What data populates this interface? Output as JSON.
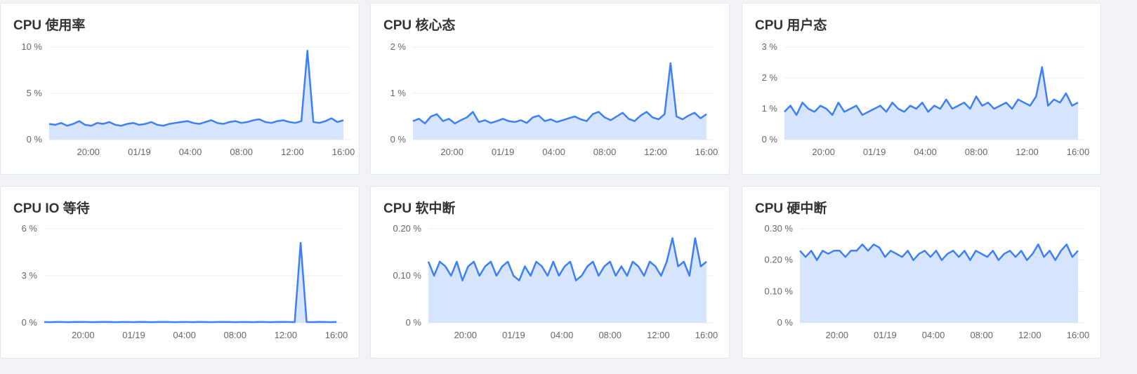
{
  "colors": {
    "line": "#3d7ff5",
    "area": "#d6e4fd",
    "grid": "#eeeeee",
    "tick": "#666666"
  },
  "chart_data": [
    {
      "type": "area",
      "title": "CPU 使用率",
      "yticks": [
        "10 %",
        "5 %",
        "0 %"
      ],
      "ylim": [
        0,
        10
      ],
      "xticks": [
        "20:00",
        "01/19",
        "04:00",
        "08:00",
        "12:00",
        "16:00"
      ],
      "series": [
        {
          "values": [
            1.7,
            1.6,
            1.8,
            1.5,
            1.7,
            2.0,
            1.6,
            1.5,
            1.8,
            1.7,
            1.9,
            1.6,
            1.5,
            1.7,
            1.8,
            1.6,
            1.7,
            1.9,
            1.6,
            1.5,
            1.7,
            1.8,
            1.9,
            2.0,
            1.8,
            1.7,
            1.9,
            2.1,
            1.8,
            1.7,
            1.9,
            2.0,
            1.8,
            1.9,
            2.1,
            2.2,
            1.9,
            1.8,
            2.0,
            2.1,
            1.9,
            1.8,
            2.0,
            9.6,
            1.9,
            1.8,
            2.0,
            2.3,
            1.9,
            2.1
          ]
        }
      ]
    },
    {
      "type": "area",
      "title": "CPU 核心态",
      "yticks": [
        "2 %",
        "1 %",
        "0 %"
      ],
      "ylim": [
        0,
        2
      ],
      "xticks": [
        "20:00",
        "01/19",
        "04:00",
        "08:00",
        "12:00",
        "16:00"
      ],
      "series": [
        {
          "values": [
            0.4,
            0.45,
            0.35,
            0.5,
            0.55,
            0.4,
            0.45,
            0.35,
            0.42,
            0.48,
            0.6,
            0.38,
            0.42,
            0.36,
            0.4,
            0.45,
            0.4,
            0.38,
            0.42,
            0.36,
            0.48,
            0.52,
            0.4,
            0.44,
            0.38,
            0.42,
            0.46,
            0.5,
            0.44,
            0.4,
            0.55,
            0.6,
            0.48,
            0.42,
            0.5,
            0.58,
            0.45,
            0.4,
            0.52,
            0.6,
            0.48,
            0.44,
            0.55,
            1.65,
            0.5,
            0.44,
            0.52,
            0.58,
            0.46,
            0.55
          ]
        }
      ]
    },
    {
      "type": "area",
      "title": "CPU 用户态",
      "yticks": [
        "3 %",
        "2 %",
        "1 %",
        "0 %"
      ],
      "ylim": [
        0,
        3
      ],
      "xticks": [
        "20:00",
        "01/19",
        "04:00",
        "08:00",
        "12:00",
        "16:00"
      ],
      "series": [
        {
          "values": [
            0.9,
            1.1,
            0.8,
            1.2,
            1.0,
            0.9,
            1.1,
            1.0,
            0.8,
            1.2,
            0.9,
            1.0,
            1.1,
            0.8,
            0.9,
            1.0,
            1.1,
            0.9,
            1.2,
            1.0,
            0.9,
            1.1,
            1.0,
            1.2,
            0.9,
            1.1,
            1.0,
            1.3,
            1.0,
            1.1,
            1.2,
            1.0,
            1.4,
            1.1,
            1.2,
            1.0,
            1.1,
            1.2,
            1.0,
            1.3,
            1.2,
            1.1,
            1.4,
            2.35,
            1.1,
            1.3,
            1.2,
            1.5,
            1.1,
            1.2
          ]
        }
      ]
    },
    {
      "type": "area",
      "title": "CPU IO 等待",
      "yticks": [
        "6 %",
        "3 %",
        "0 %"
      ],
      "ylim": [
        0,
        6
      ],
      "xticks": [
        "20:00",
        "01/19",
        "04:00",
        "08:00",
        "12:00",
        "16:00"
      ],
      "series": [
        {
          "values": [
            0.05,
            0.04,
            0.06,
            0.05,
            0.04,
            0.05,
            0.06,
            0.05,
            0.04,
            0.05,
            0.06,
            0.05,
            0.04,
            0.05,
            0.05,
            0.04,
            0.06,
            0.05,
            0.04,
            0.05,
            0.06,
            0.05,
            0.04,
            0.05,
            0.05,
            0.04,
            0.06,
            0.05,
            0.04,
            0.05,
            0.06,
            0.05,
            0.04,
            0.05,
            0.05,
            0.04,
            0.06,
            0.05,
            0.04,
            0.05,
            0.06,
            0.05,
            0.04,
            5.1,
            0.05,
            0.04,
            0.06,
            0.05,
            0.04,
            0.05
          ]
        }
      ]
    },
    {
      "type": "area",
      "title": "CPU 软中断",
      "yticks": [
        "0.20 %",
        "0.10 %",
        "0 %"
      ],
      "ylim": [
        0,
        0.2
      ],
      "xticks": [
        "20:00",
        "01/19",
        "04:00",
        "08:00",
        "12:00",
        "16:00"
      ],
      "series": [
        {
          "values": [
            0.13,
            0.1,
            0.13,
            0.12,
            0.1,
            0.13,
            0.09,
            0.12,
            0.13,
            0.1,
            0.12,
            0.13,
            0.1,
            0.12,
            0.13,
            0.1,
            0.09,
            0.12,
            0.1,
            0.13,
            0.12,
            0.1,
            0.13,
            0.1,
            0.12,
            0.13,
            0.09,
            0.1,
            0.12,
            0.13,
            0.1,
            0.12,
            0.13,
            0.1,
            0.12,
            0.1,
            0.13,
            0.12,
            0.1,
            0.13,
            0.12,
            0.1,
            0.13,
            0.18,
            0.12,
            0.13,
            0.1,
            0.18,
            0.12,
            0.13
          ]
        }
      ]
    },
    {
      "type": "area",
      "title": "CPU 硬中断",
      "yticks": [
        "0.30 %",
        "0.20 %",
        "0.10 %",
        "0 %"
      ],
      "ylim": [
        0,
        0.3
      ],
      "xticks": [
        "20:00",
        "01/19",
        "04:00",
        "08:00",
        "12:00",
        "16:00"
      ],
      "series": [
        {
          "values": [
            0.23,
            0.21,
            0.23,
            0.2,
            0.23,
            0.22,
            0.23,
            0.23,
            0.21,
            0.23,
            0.23,
            0.25,
            0.23,
            0.25,
            0.24,
            0.21,
            0.23,
            0.22,
            0.21,
            0.23,
            0.2,
            0.22,
            0.23,
            0.21,
            0.23,
            0.2,
            0.22,
            0.23,
            0.21,
            0.23,
            0.2,
            0.23,
            0.22,
            0.21,
            0.23,
            0.2,
            0.22,
            0.23,
            0.21,
            0.23,
            0.2,
            0.22,
            0.25,
            0.21,
            0.23,
            0.2,
            0.23,
            0.25,
            0.21,
            0.23
          ]
        }
      ]
    }
  ]
}
